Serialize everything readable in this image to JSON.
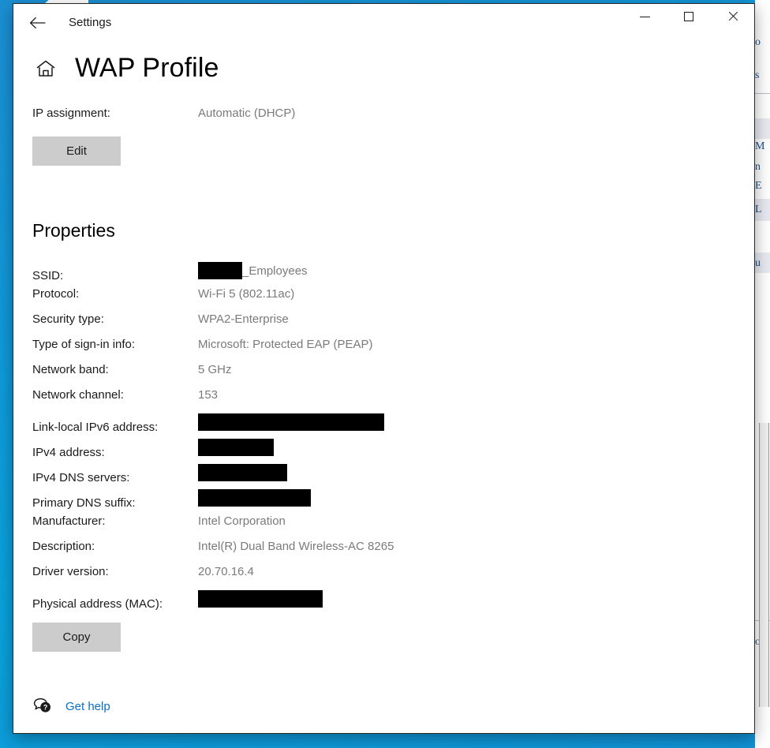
{
  "window": {
    "app_title": "Settings",
    "back_icon": "back-arrow-icon",
    "minimize_label": "Minimize",
    "maximize_label": "Maximize",
    "close_label": "Close"
  },
  "page": {
    "home_icon": "home-icon",
    "title": "WAP Profile"
  },
  "ip_assignment": {
    "label": "IP assignment:",
    "value": "Automatic (DHCP)",
    "edit_label": "Edit"
  },
  "properties": {
    "heading": "Properties",
    "rows": [
      {
        "label": "SSID:",
        "value": "_Employees",
        "redacted": true,
        "redact_width": 56,
        "value_after": true
      },
      {
        "label": "Protocol:",
        "value": "Wi-Fi 5 (802.11ac)",
        "redacted": false
      },
      {
        "label": "Security type:",
        "value": "WPA2-Enterprise",
        "redacted": false
      },
      {
        "label": "Type of sign-in info:",
        "value": "Microsoft: Protected EAP (PEAP)",
        "redacted": false
      },
      {
        "label": "Network band:",
        "value": "5 GHz",
        "redacted": false
      },
      {
        "label": "Network channel:",
        "value": "153",
        "redacted": false
      },
      {
        "label": "Link-local IPv6 address:",
        "value": "",
        "redacted": true,
        "redact_width": 236
      },
      {
        "label": "IPv4 address:",
        "value": "",
        "redacted": true,
        "redact_width": 96
      },
      {
        "label": "IPv4 DNS servers:",
        "value": "",
        "redacted": true,
        "redact_width": 113
      },
      {
        "label": "Primary DNS suffix:",
        "value": "",
        "redacted": true,
        "redact_width": 143
      },
      {
        "label": "Manufacturer:",
        "value": "Intel Corporation",
        "redacted": false
      },
      {
        "label": "Description:",
        "value": "Intel(R) Dual Band Wireless-AC 8265",
        "redacted": false
      },
      {
        "label": "Driver version:",
        "value": "20.70.16.4",
        "redacted": false
      },
      {
        "label": "Physical address (MAC):",
        "value": "",
        "redacted": true,
        "redact_width": 158
      }
    ],
    "copy_label": "Copy"
  },
  "footer": {
    "help_icon": "help-speech-bubble-icon",
    "help_label": "Get help"
  },
  "colors": {
    "desktop_blue": "#0f9ada",
    "button_gray": "#cccccc",
    "value_gray": "#7a7a7a",
    "link_blue": "#0b6ec6",
    "redaction_black": "#000000"
  }
}
